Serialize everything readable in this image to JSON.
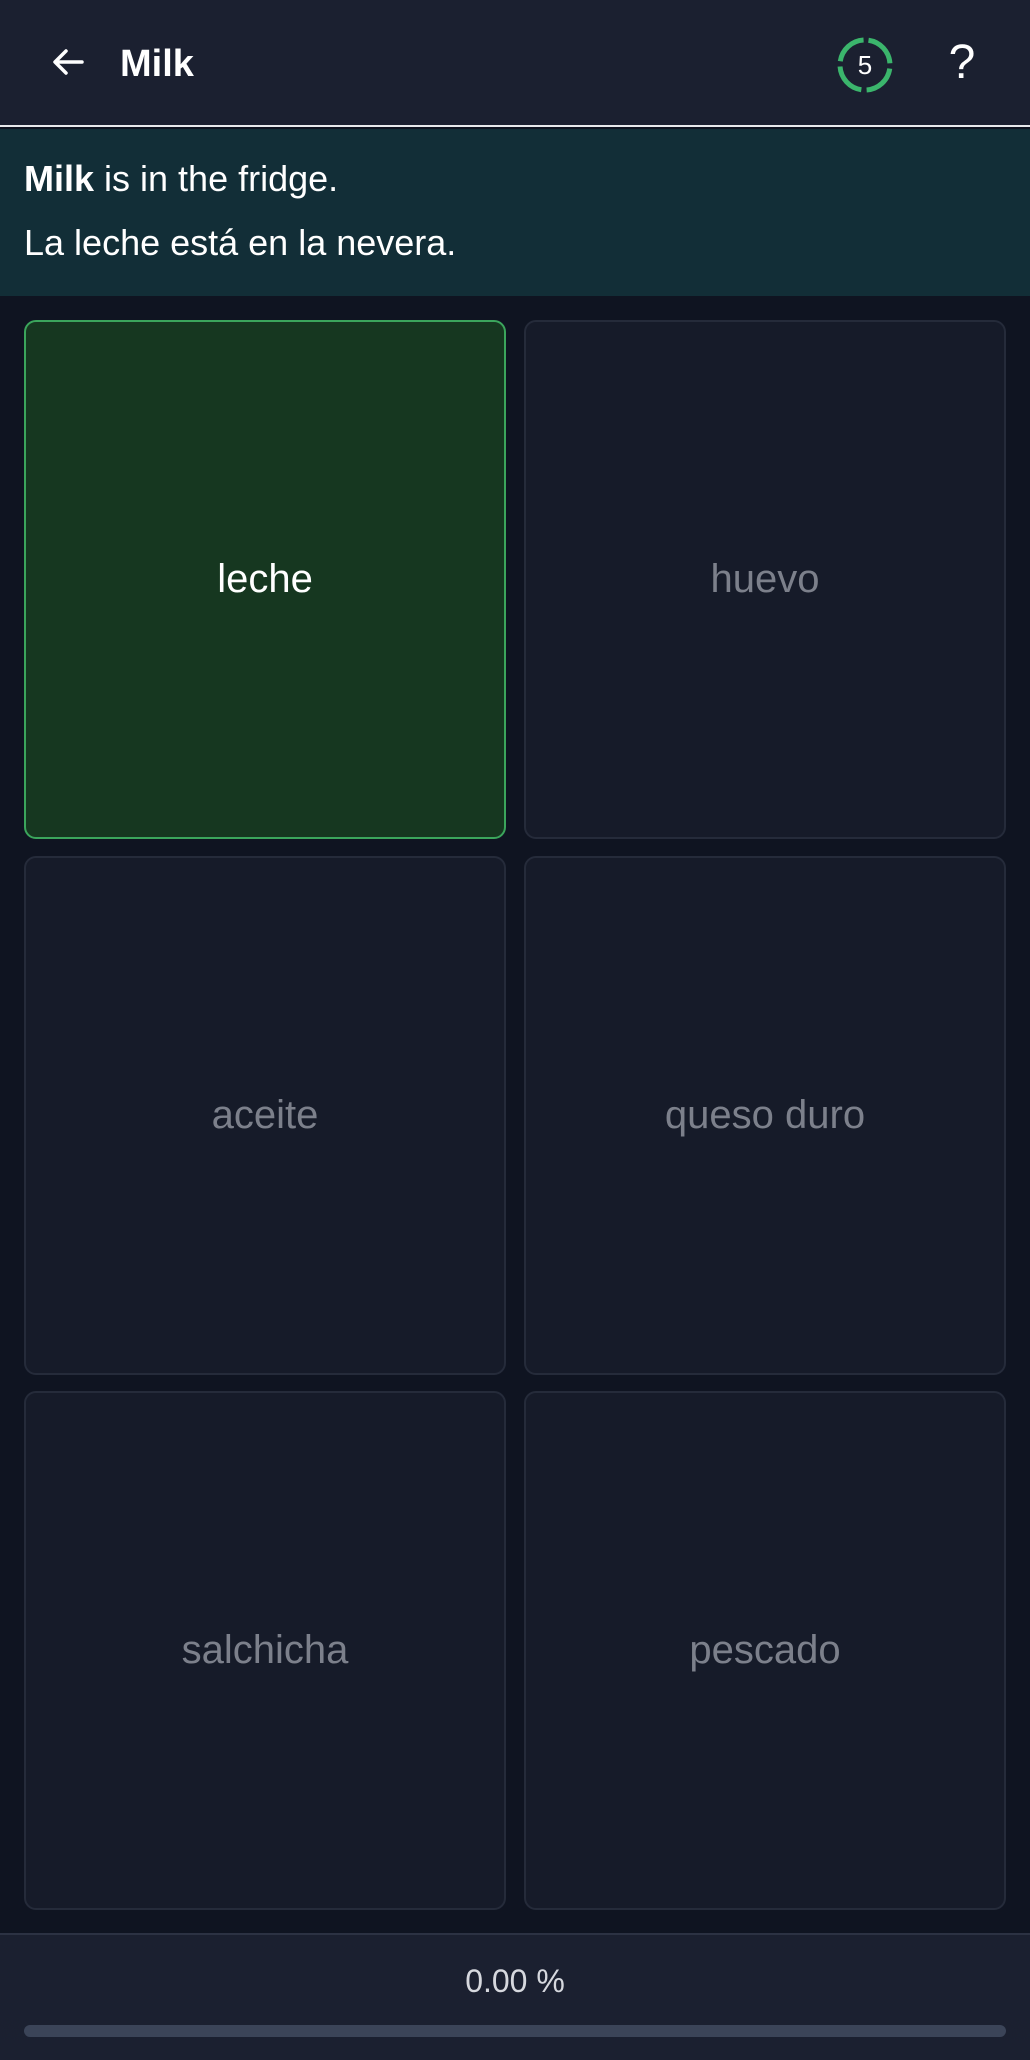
{
  "header": {
    "title": "Milk",
    "back_icon": "arrow-left-icon",
    "counter": "5",
    "counter_color": "#3bb56c",
    "help_label": "?"
  },
  "sentence": {
    "en_highlight": "Milk",
    "en_rest": " is in the fridge.",
    "es": "La leche está en la nevera."
  },
  "options": [
    {
      "label": "leche",
      "selected": true
    },
    {
      "label": "huevo",
      "selected": false
    },
    {
      "label": "aceite",
      "selected": false
    },
    {
      "label": "queso duro",
      "selected": false
    },
    {
      "label": "salchicha",
      "selected": false
    },
    {
      "label": "pescado",
      "selected": false
    }
  ],
  "footer": {
    "percent_label": "0.00 %",
    "progress": 0
  },
  "colors": {
    "selected_bg": "#163720",
    "selected_border": "#3ba55c",
    "panel_bg": "#122e37"
  }
}
